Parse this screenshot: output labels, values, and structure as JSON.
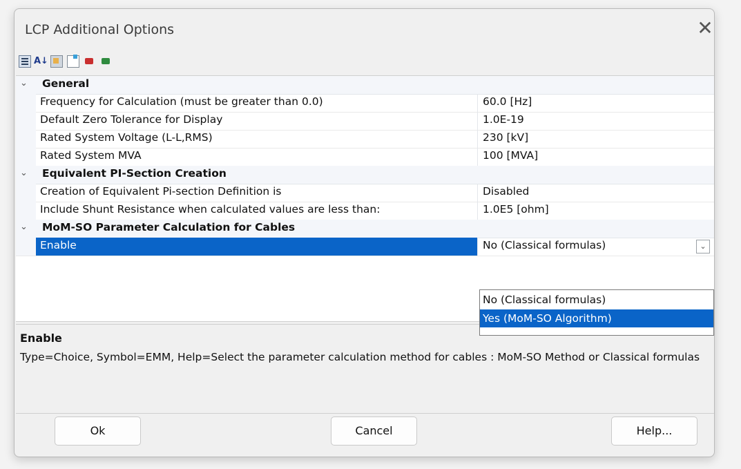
{
  "window": {
    "title": "LCP Additional Options",
    "close_glyph": "✕"
  },
  "toolbar": {
    "icons": [
      "categorized-icon",
      "alphabetical-sort-icon",
      "property-pages-icon",
      "new-page-icon",
      "export-icon",
      "import-icon"
    ],
    "sort_glyph": "A↓"
  },
  "grid": {
    "categories": [
      {
        "label": "General",
        "chevron": "⌄"
      },
      {
        "label": "Equivalent PI-Section Creation",
        "chevron": "⌄"
      },
      {
        "label": "MoM-SO Parameter Calculation for Cables",
        "chevron": "⌄"
      }
    ],
    "rows": [
      {
        "name": "Frequency for Calculation (must be greater than 0.0)",
        "value": "60.0 [Hz]"
      },
      {
        "name": "Default Zero Tolerance for Display",
        "value": "1.0E-19"
      },
      {
        "name": "Rated System Voltage (L-L,RMS)",
        "value": "230 [kV]"
      },
      {
        "name": "Rated System MVA",
        "value": "100 [MVA]"
      },
      {
        "name": "Creation of Equivalent Pi-section Definition is",
        "value": "Disabled"
      },
      {
        "name": "Include Shunt Resistance when calculated values are less than:",
        "value": "1.0E5 [ohm]"
      },
      {
        "name": "Enable",
        "value": "No (Classical formulas)"
      }
    ],
    "dropdown_options": [
      "No (Classical formulas)",
      "Yes (MoM-SO Algorithm)"
    ],
    "combo_glyph": "⌄"
  },
  "description": {
    "title": "Enable",
    "body": "Type=Choice, Symbol=EMM, Help=Select the parameter calculation method for cables : MoM-SO Method  or Classical formulas"
  },
  "buttons": {
    "ok": "Ok",
    "cancel": "Cancel",
    "help": "Help..."
  },
  "colors": {
    "selection": "#0a64c8",
    "category_bg": "#f4f6fa"
  }
}
